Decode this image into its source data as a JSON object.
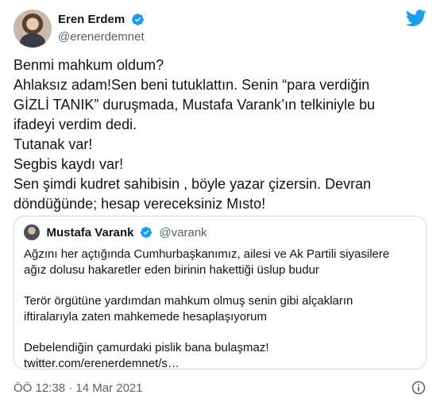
{
  "author": {
    "name": "Eren Erdem",
    "handle": "@erenerdemnet",
    "verified": true
  },
  "tweet_lines": [
    "Benmi mahkum oldum?",
    "Ahlaksız adam!Sen beni tutuklattın. Senin “para verdiğin",
    "GİZLİ TANIK” duruşmada, Mustafa Varank’ın telkiniyle bu",
    "ifadeyi verdim dedi.",
    "Tutanak var!",
    "Segbis kaydı var!",
    "Sen şimdi kudret sahibisin , böyle yazar çizersin. Devran",
    "döndüğünde; hesap vereceksiniz Mısto!"
  ],
  "quoted": {
    "name": "Mustafa Varank",
    "handle": "@varank",
    "verified": true,
    "paragraphs": [
      [
        "Ağzını her açtığında Cumhurbaşkanımız, ailesi ve Ak Partili siyasilere",
        "ağız dolusu hakaretler eden birinin hakettiği üslup budur"
      ],
      [
        "Terör örgütüne yardımdan mahkum olmuş senin gibi alçakların",
        "iftiralarıyla zaten mahkemede hesaplaşıyorum"
      ],
      [
        "Debelendiğin çamurdaki pislik bana bulaşmaz!",
        "twitter.com/erenerdemnet/s…"
      ]
    ]
  },
  "footer": {
    "timestamp": "ÖÖ 12:38 · 14 Mar 2021"
  },
  "icons": {
    "brand": "twitter-bird-icon",
    "verified": "verified-badge-icon",
    "info": "info-icon"
  },
  "colors": {
    "brand": "#1d9bf0",
    "text": "#0f1419",
    "secondary": "#536471",
    "border": "#cfd9de"
  }
}
